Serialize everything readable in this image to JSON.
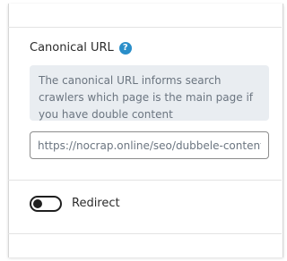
{
  "canonical": {
    "heading": "Canonical URL",
    "help_icon": "?",
    "hint": "The canonical URL informs search crawlers which page is the main page if you have double content",
    "url_value": "https://nocrap.online/seo/dubbele-content-"
  },
  "redirect": {
    "label": "Redirect",
    "enabled": false
  },
  "colors": {
    "accent": "#2a8ec9",
    "hint_bg": "#e9edf1",
    "hint_text": "#6b7580"
  }
}
